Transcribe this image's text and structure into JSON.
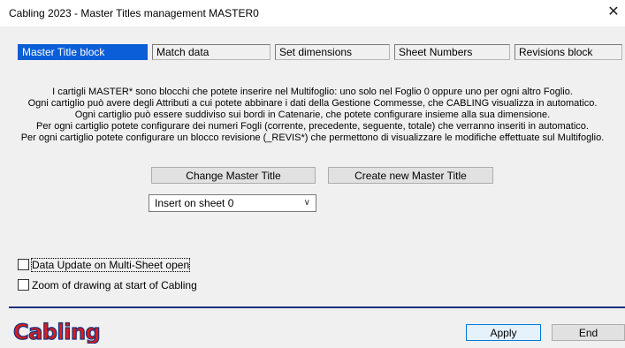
{
  "window": {
    "title": "Cabling 2023 - Master Titles management MASTER0",
    "close_glyph": "✕"
  },
  "tabs": [
    {
      "label": "Master Title block",
      "active": true
    },
    {
      "label": "Match data",
      "active": false
    },
    {
      "label": "Set dimensions",
      "active": false
    },
    {
      "label": "Sheet Numbers",
      "active": false
    },
    {
      "label": "Revisions block",
      "active": false
    }
  ],
  "description": [
    "I cartigli MASTER* sono blocchi che potete inserire nel Multifoglio: uno solo nel Foglio 0 oppure uno per ogni altro Foglio.",
    "Ogni cartiglio può avere degli Attributi a cui potete abbinare i dati della Gestione Commesse, che CABLING visualizza in automatico.",
    "Ogni cartiglio può essere suddiviso sui bordi in Catenarie, che potete configurare insieme alla sua dimensione.",
    "Per ogni cartiglio potete configurare dei numeri Fogli (corrente, precedente, seguente, totale) che verranno inseriti in automatico.",
    "Per ogni cartiglio potete configurare un blocco revisione (_REVIS*) che permettono di visualizzare le modifiche effettuate sul Multifoglio."
  ],
  "buttons": {
    "change_master": "Change Master Title",
    "create_master": "Create new Master Title",
    "apply": "Apply",
    "end": "End"
  },
  "insert_select": {
    "value": "Insert on sheet 0",
    "chevron_icon": "chevron-down-icon"
  },
  "checkboxes": [
    {
      "label": "Data Update on Multi-Sheet open",
      "checked": false
    },
    {
      "label": "Zoom of drawing at start of Cabling",
      "checked": false
    }
  ],
  "logo": {
    "text": "Cabling",
    "color": "#d81e1e",
    "outline": "#1a2f7a"
  },
  "colors": {
    "accent": "#0b5ed7",
    "divider": "#1a2f7a"
  }
}
